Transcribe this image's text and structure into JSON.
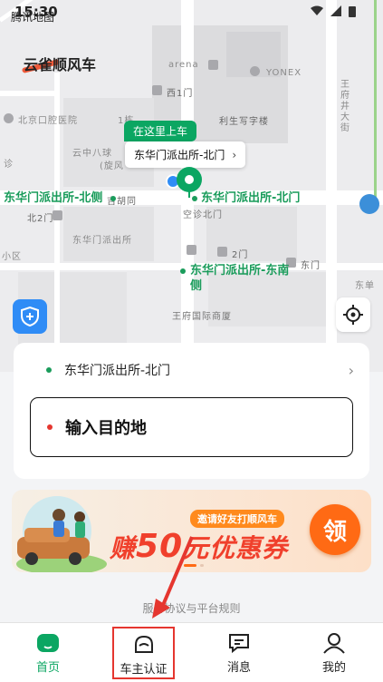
{
  "status_bar": {
    "time": "15:30",
    "map_app_label": "腾讯地图"
  },
  "brand": {
    "name": "云雀顺风车"
  },
  "map": {
    "labels": {
      "arena": "arena",
      "yonex": "YONEX",
      "west_gate_1": "西1门",
      "hospital": "北京口腔医院",
      "building_1": "1栋",
      "lisheng": "利生写字楼",
      "cloud_ball": "云中八球",
      "xuan": "(旋风",
      "hutong": "吉胡同",
      "north_gate_2": "北2门",
      "dhm_station": "东华门派出所",
      "kongxiao": "空诊北门",
      "east_gate_2": "2门",
      "east_gate": "东门",
      "small_area": "小区",
      "clinic": "诊",
      "wangfu_mall": "王府国际商厦",
      "wangfujing": "王府井大街",
      "dong_dan": "东单"
    },
    "poi_left": "东华门派出所-北侧",
    "poi_center": "东华门派出所-北门",
    "poi_south": "东华门派出所-东南侧",
    "pickup_tag": "在这里上车",
    "pickup_name": "东华门派出所-北门"
  },
  "route": {
    "start_label": "东华门派出所-北门",
    "destination_placeholder": "输入目的地"
  },
  "banner": {
    "invite_tag": "邀请好友打顺风车",
    "prefix": "赚",
    "amount": "50",
    "suffix": "元优惠券",
    "cta": "领"
  },
  "agreement_link": "服务协议与平台规则",
  "tabs": [
    {
      "label": "首页"
    },
    {
      "label": "车主认证"
    },
    {
      "label": "消息"
    },
    {
      "label": "我的"
    }
  ],
  "colors": {
    "accent": "#0ba662",
    "brand_red": "#e5362f",
    "banner_orange": "#ff6a14"
  }
}
